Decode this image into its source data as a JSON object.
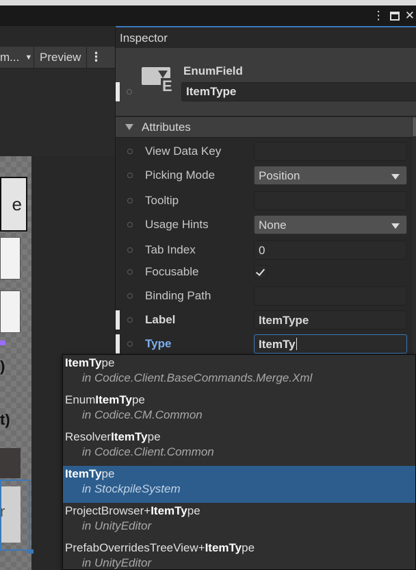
{
  "window": {
    "kebab_glyph": "⋮",
    "close_glyph": "✕"
  },
  "left_panel": {
    "mode_dropdown_text": "m...",
    "preview_label": "Preview",
    "kebab_glyph": "⋮",
    "canvas_glyph_e": "e",
    "canvas_paren_1": ")",
    "canvas_paren_2": "t)",
    "canvas_glyph_r": "r"
  },
  "inspector": {
    "tab_label": "Inspector",
    "element_type": "EnumField",
    "element_icon": "enum-field-icon",
    "element_name": "ItemType",
    "foldout_label": "Attributes",
    "rows": [
      {
        "label": "View Data Key",
        "value": ""
      },
      {
        "label": "Picking Mode",
        "value": "Position"
      },
      {
        "label": "Tooltip",
        "value": ""
      },
      {
        "label": "Usage Hints",
        "value": "None"
      },
      {
        "label": "Tab Index",
        "value": "0"
      },
      {
        "label": "Focusable",
        "checked": true
      },
      {
        "label": "Binding Path",
        "value": ""
      },
      {
        "label": "Label",
        "value": "ItemType"
      },
      {
        "label": "Type",
        "value": "ItemTy"
      }
    ]
  },
  "completion": {
    "query": "ItemTy",
    "items": [
      {
        "prefix": "",
        "match": "ItemTy",
        "suffix": "pe",
        "namespace_prefix": "in ",
        "namespace": "Codice.Client.BaseCommands.Merge.Xml",
        "selected": false
      },
      {
        "prefix": "Enum",
        "match": "ItemTy",
        "suffix": "pe",
        "namespace_prefix": "in ",
        "namespace": "Codice.CM.Common",
        "selected": false
      },
      {
        "prefix": "Resolver",
        "match": "ItemTy",
        "suffix": "pe",
        "namespace_prefix": "in ",
        "namespace": "Codice.Client.Common",
        "selected": false
      },
      {
        "prefix": "",
        "match": "ItemTy",
        "suffix": "pe",
        "namespace_prefix": "in ",
        "namespace": "StockpileSystem",
        "selected": true
      },
      {
        "prefix": "ProjectBrowser+",
        "match": "ItemTy",
        "suffix": "pe",
        "namespace_prefix": "in ",
        "namespace": "UnityEditor",
        "selected": false
      },
      {
        "prefix": "PrefabOverridesTreeView+",
        "match": "ItemTy",
        "suffix": "pe",
        "namespace_prefix": "in ",
        "namespace": "UnityEditor",
        "selected": false
      }
    ]
  },
  "colors": {
    "accent_blue": "#3a79bb",
    "selection_blue": "#2c5d8d",
    "type_label_blue": "#7bb0f0"
  }
}
